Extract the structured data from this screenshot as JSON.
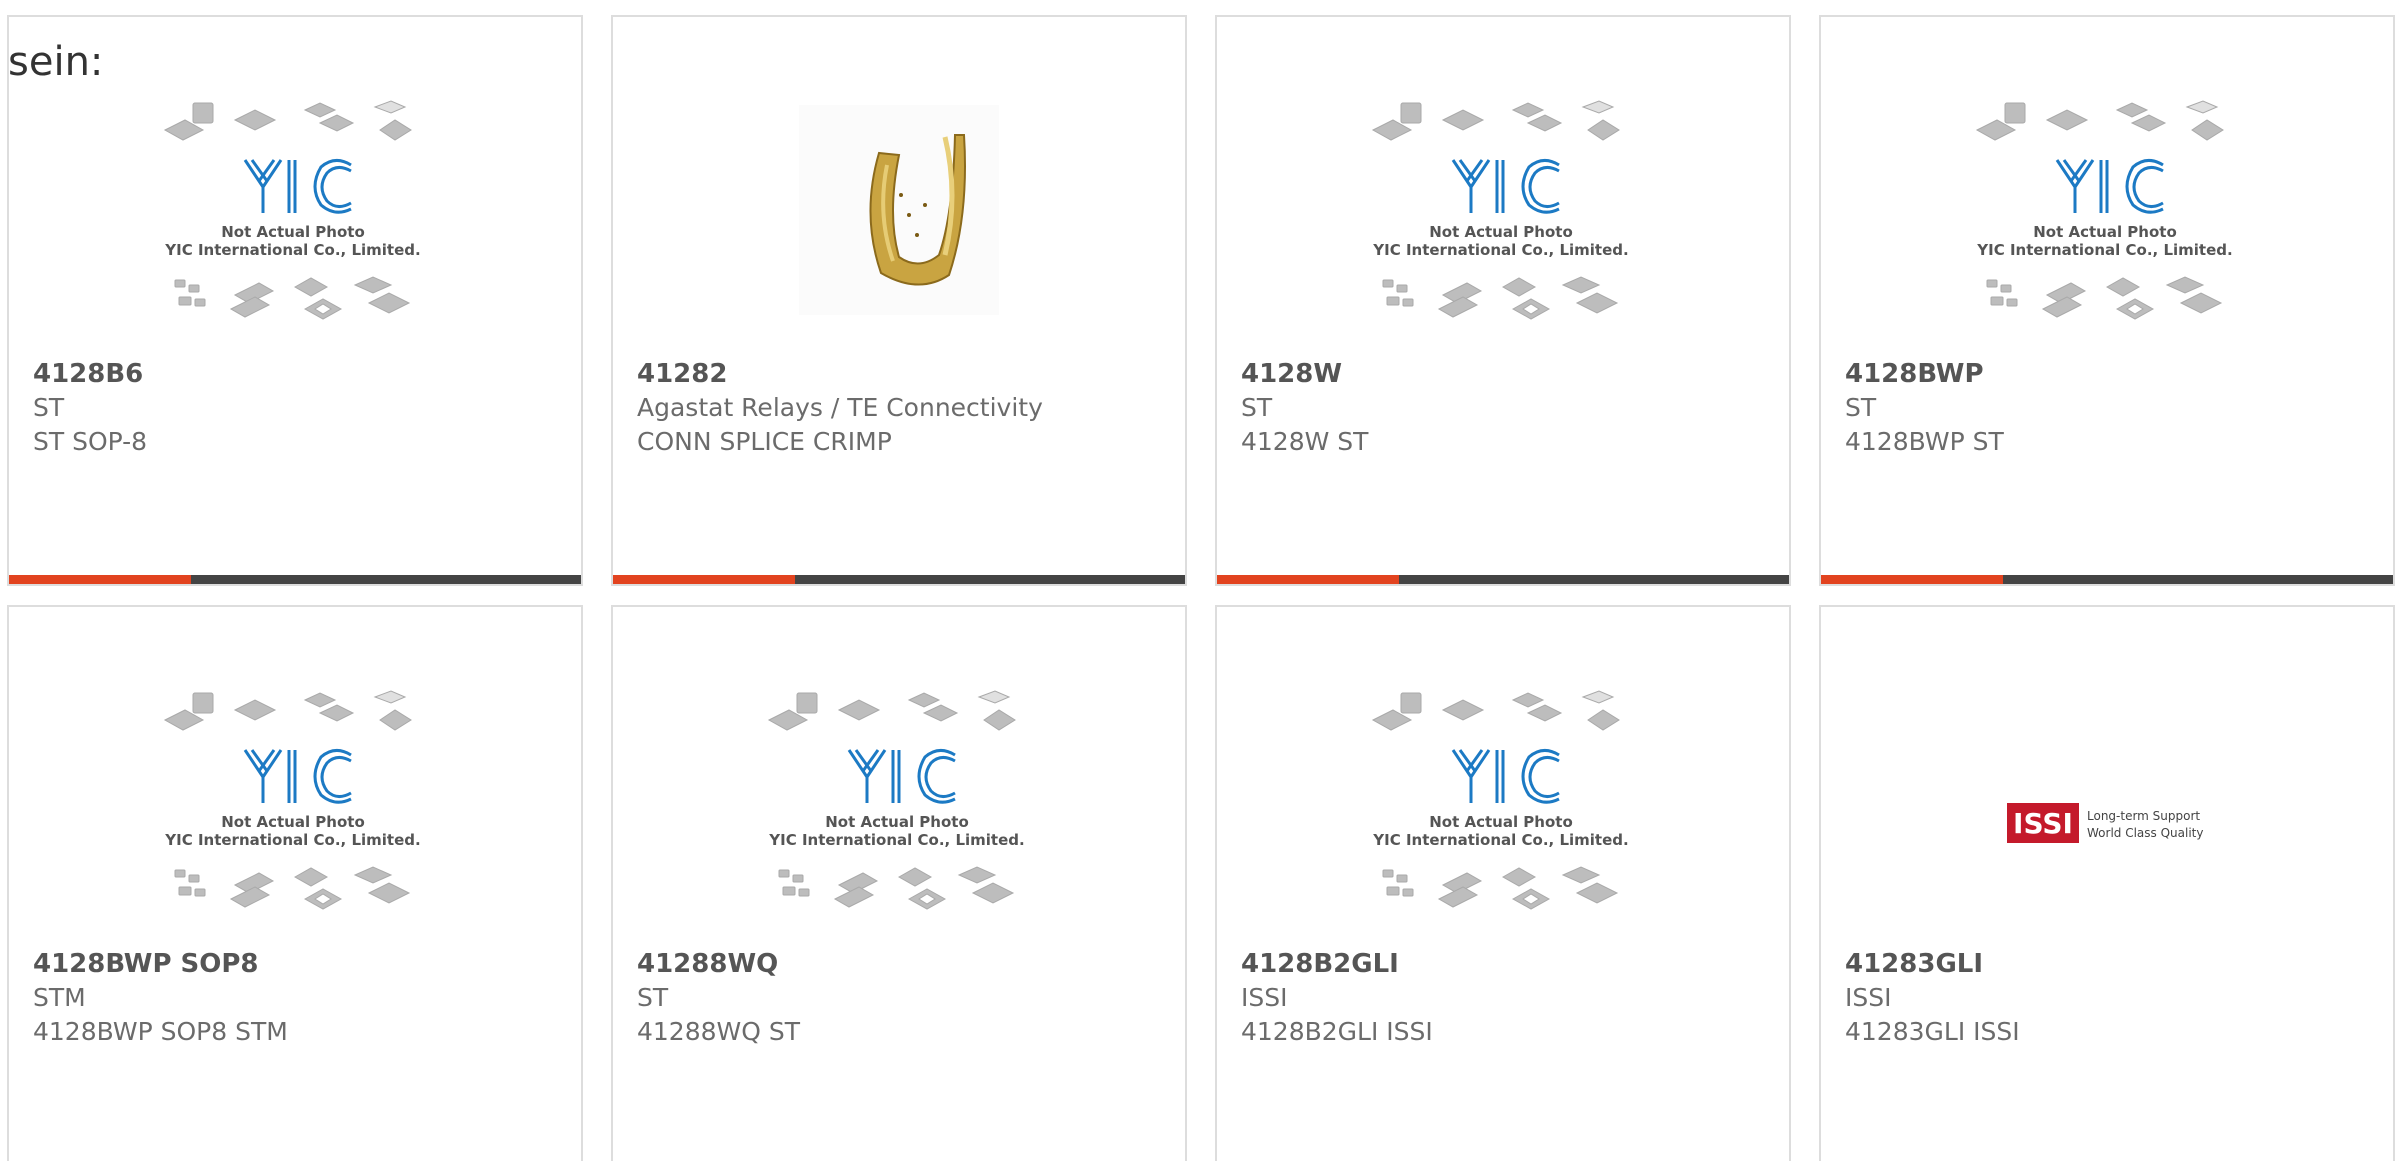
{
  "heading": "sein:",
  "colors": {
    "accent": "#e2431f",
    "bar": "#444444",
    "logo_blue": "#1c7ac4",
    "issi_red": "#c41a2b"
  },
  "placeholder_image": {
    "line1": "Not Actual Photo",
    "line2": "YIC International Co., Limited."
  },
  "issi_logo": {
    "mark": "ISSI",
    "tag1": "Long-term Support",
    "tag2": "World Class Quality"
  },
  "products": [
    {
      "part": "4128B6",
      "manufacturer": "ST",
      "description": "ST SOP-8",
      "image": "yic-placeholder"
    },
    {
      "part": "41282",
      "manufacturer": "Agastat Relays / TE Connectivity",
      "description": "CONN SPLICE CRIMP",
      "image": "brass-splice-photo"
    },
    {
      "part": "4128W",
      "manufacturer": "ST",
      "description": "4128W ST",
      "image": "yic-placeholder"
    },
    {
      "part": "4128BWP",
      "manufacturer": "ST",
      "description": "4128BWP ST",
      "image": "yic-placeholder"
    },
    {
      "part": "4128BWP SOP8",
      "manufacturer": "STM",
      "description": "4128BWP SOP8 STM",
      "image": "yic-placeholder"
    },
    {
      "part": "41288WQ",
      "manufacturer": "ST",
      "description": "41288WQ ST",
      "image": "yic-placeholder"
    },
    {
      "part": "4128B2GLI",
      "manufacturer": "ISSI",
      "description": "4128B2GLI ISSI",
      "image": "yic-placeholder"
    },
    {
      "part": "41283GLI",
      "manufacturer": "ISSI",
      "description": "41283GLI ISSI",
      "image": "issi-logo"
    }
  ]
}
